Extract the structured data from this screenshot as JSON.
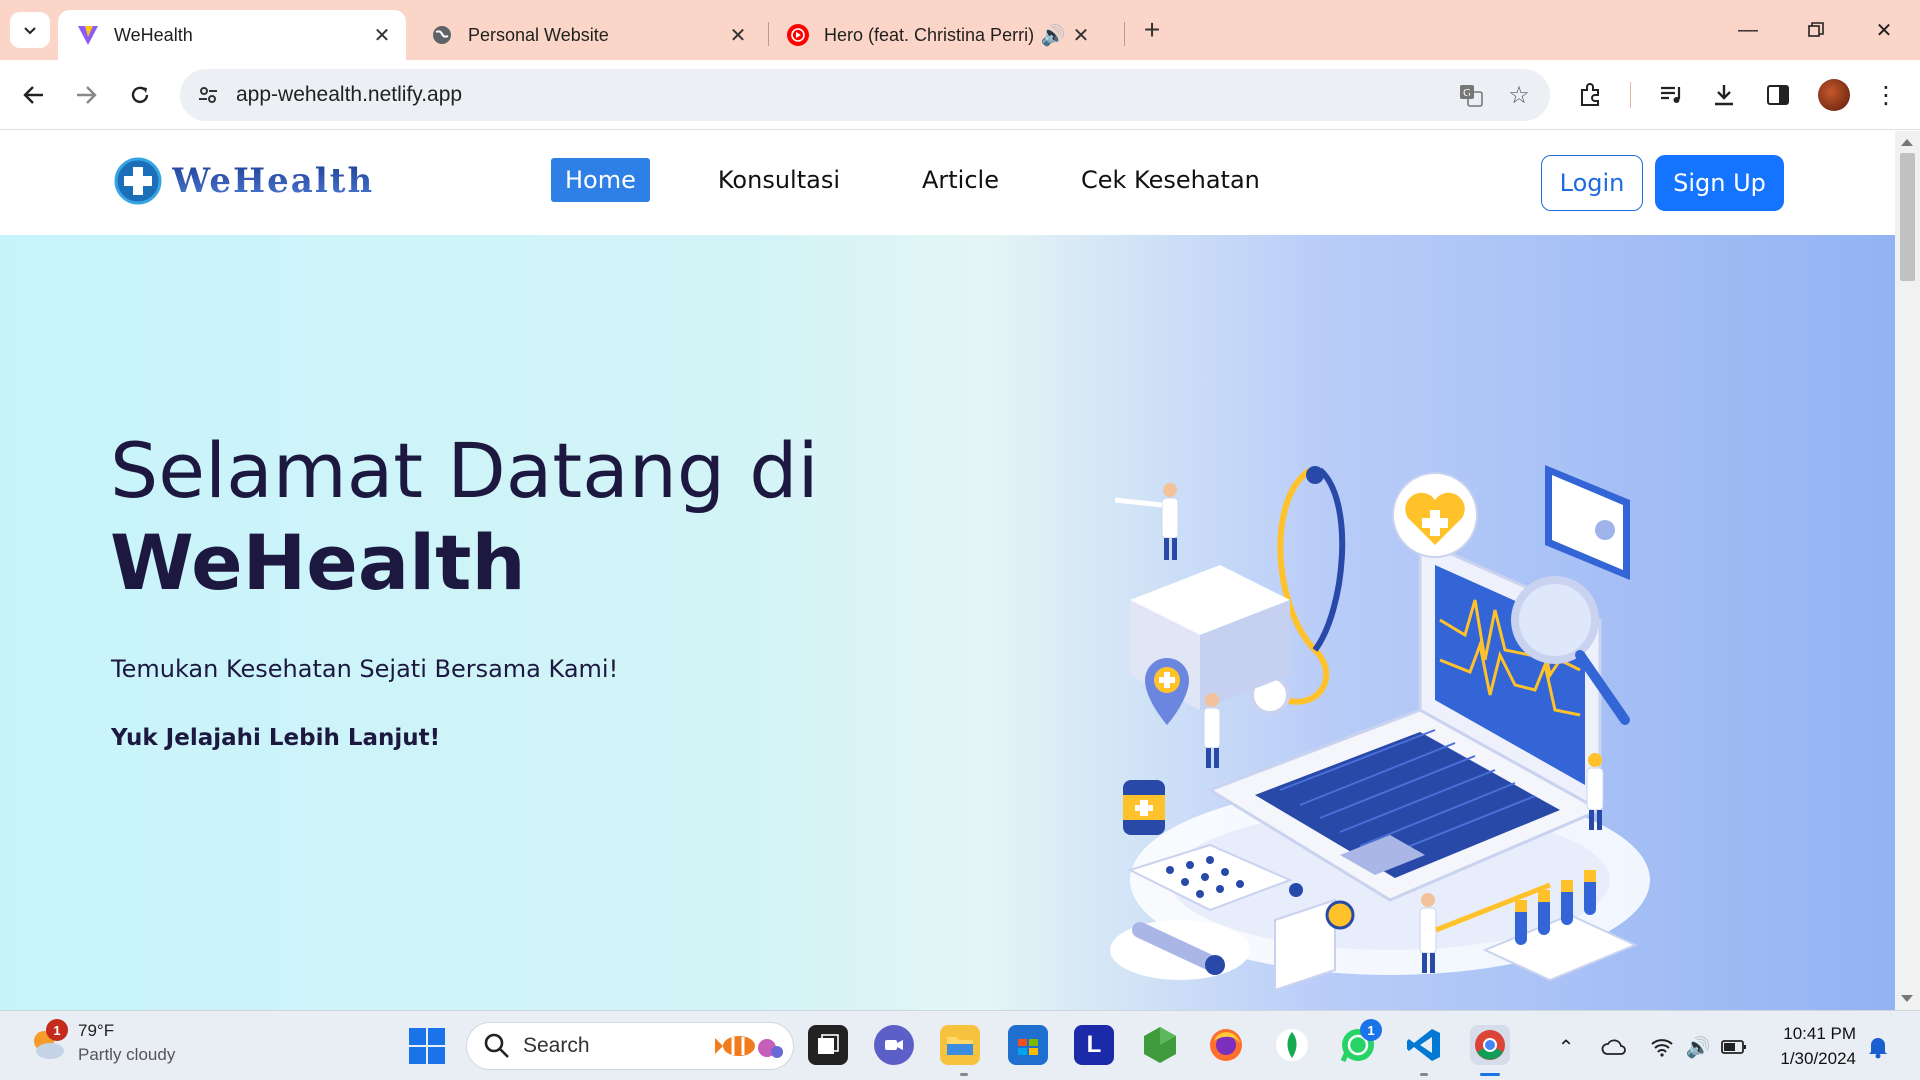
{
  "browser": {
    "tabs": [
      {
        "title": "WeHealth",
        "active": true
      },
      {
        "title": "Personal Website",
        "active": false
      },
      {
        "title": "Hero (feat. Christina Perri) -",
        "active": false,
        "audio": true
      }
    ],
    "url": "app-wehealth.netlify.app"
  },
  "site": {
    "logo_text": "WeHealth",
    "nav": [
      {
        "label": "Home",
        "active": true
      },
      {
        "label": "Konsultasi",
        "active": false
      },
      {
        "label": "Article",
        "active": false
      },
      {
        "label": "Cek Kesehatan",
        "active": false
      }
    ],
    "login_label": "Login",
    "signup_label": "Sign Up",
    "hero": {
      "heading_line1": "Selamat Datang di",
      "heading_line2": "WeHealth",
      "tagline": "Temukan Kesehatan Sejati Bersama Kami!",
      "cta": "Yuk Jelajahi Lebih Lanjut!"
    }
  },
  "taskbar": {
    "weather_temp": "79°F",
    "weather_condition": "Partly cloudy",
    "weather_badge": "1",
    "search_label": "Search",
    "whatsapp_badge": "1",
    "time": "10:41 PM",
    "date": "1/30/2024"
  },
  "colors": {
    "accent": "#1473ff",
    "nav_active": "#2e80e6",
    "heading": "#1d1840",
    "tab_strip": "#fbd6c8"
  }
}
